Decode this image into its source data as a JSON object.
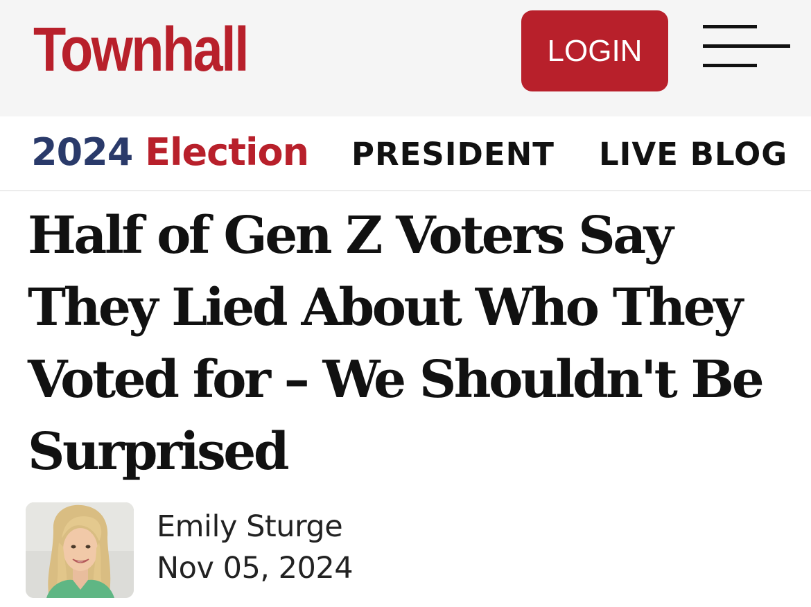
{
  "header": {
    "logo_text": "Townhall",
    "login_label": "LOGIN",
    "menu_icon": "hamburger-menu-icon"
  },
  "subnav": {
    "section_year": "2024",
    "section_word": "Election",
    "links": [
      {
        "label": "PRESIDENT"
      },
      {
        "label": "LIVE BLOG"
      }
    ]
  },
  "article": {
    "headline": "Half of Gen Z Voters Say They Lied About Who They Voted for – We Shouldn't Be Surprised",
    "author": "Emily Sturge",
    "date": "Nov 05, 2024",
    "author_photo": "author-avatar"
  },
  "colors": {
    "brand_red": "#b8202b",
    "navy": "#2a3a6a",
    "topbar_bg": "#f5f5f5",
    "text": "#111111"
  }
}
